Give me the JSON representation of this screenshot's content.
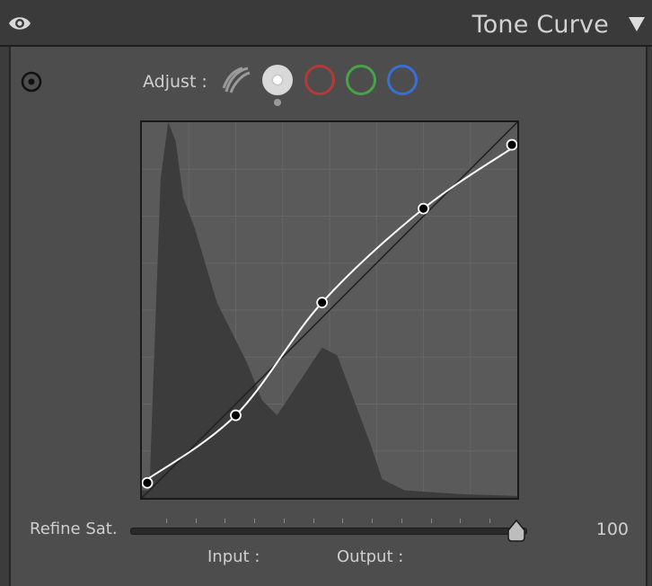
{
  "panel": {
    "title": "Tone Curve"
  },
  "icons": {
    "visibility": "eye-icon",
    "collapse": "triangle-down-icon",
    "target_adjust": "target-icon"
  },
  "adjust": {
    "label": "Adjust :",
    "channels": [
      {
        "id": "parametric",
        "icon": "parametric-curve-icon"
      },
      {
        "id": "point",
        "icon": "point-curve-icon",
        "selected": true
      },
      {
        "id": "red",
        "icon": "red-channel-icon",
        "color": "#b43a3a"
      },
      {
        "id": "green",
        "icon": "green-channel-icon",
        "color": "#48a347"
      },
      {
        "id": "blue",
        "icon": "blue-channel-icon",
        "color": "#3a6fd3"
      }
    ]
  },
  "curve": {
    "points": [
      [
        0,
        0.04
      ],
      [
        0.25,
        0.22
      ],
      [
        0.48,
        0.52
      ],
      [
        0.75,
        0.77
      ],
      [
        1.0,
        0.94
      ]
    ],
    "histogram": [
      [
        0,
        0.02
      ],
      [
        0.02,
        0.02
      ],
      [
        0.03,
        0.3
      ],
      [
        0.05,
        0.85
      ],
      [
        0.07,
        1.0
      ],
      [
        0.09,
        0.95
      ],
      [
        0.11,
        0.8
      ],
      [
        0.14,
        0.72
      ],
      [
        0.17,
        0.62
      ],
      [
        0.2,
        0.52
      ],
      [
        0.24,
        0.44
      ],
      [
        0.28,
        0.36
      ],
      [
        0.32,
        0.26
      ],
      [
        0.36,
        0.22
      ],
      [
        0.4,
        0.28
      ],
      [
        0.44,
        0.34
      ],
      [
        0.48,
        0.4
      ],
      [
        0.52,
        0.38
      ],
      [
        0.55,
        0.3
      ],
      [
        0.58,
        0.22
      ],
      [
        0.61,
        0.14
      ],
      [
        0.64,
        0.05
      ],
      [
        0.7,
        0.02
      ],
      [
        0.85,
        0.01
      ],
      [
        1.0,
        0.005
      ]
    ],
    "grid_divisions": 8
  },
  "refine_saturation": {
    "label": "Refine Sat.",
    "value": "100",
    "fraction": 1.0,
    "tick_count": 12
  },
  "readout": {
    "input_label": "Input :",
    "output_label": "Output :"
  }
}
